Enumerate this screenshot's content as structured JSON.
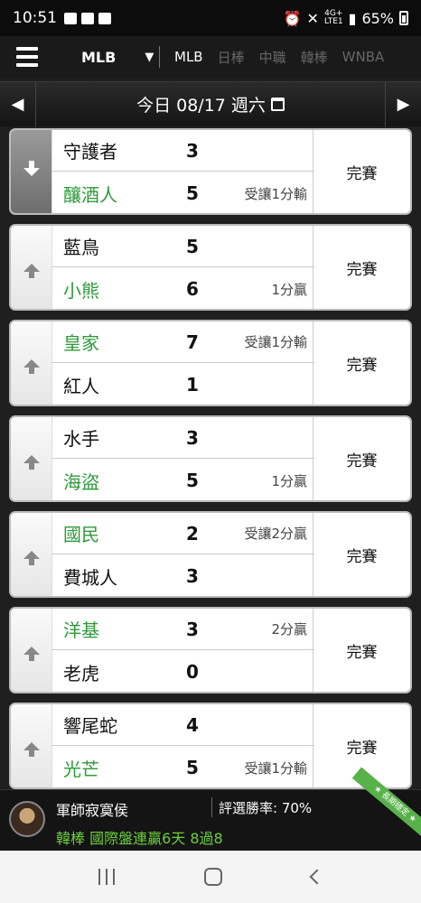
{
  "status_bar": {
    "time": "10:51",
    "network": "4G+",
    "network_sub": "LTE1",
    "battery": "65%"
  },
  "nav": {
    "selected_league": "MLB",
    "tabs": [
      {
        "label": "MLB",
        "active": true
      },
      {
        "label": "日棒",
        "active": false
      },
      {
        "label": "中職",
        "active": false
      },
      {
        "label": "韓棒",
        "active": false
      },
      {
        "label": "WNBA",
        "active": false
      }
    ]
  },
  "date_label": "今日 08/17 週六",
  "games": [
    {
      "expanded": true,
      "home": {
        "team": "守護者",
        "score": "3",
        "note": "",
        "green": false
      },
      "away": {
        "team": "釀酒人",
        "score": "5",
        "note": "受讓1分輸",
        "green": true
      },
      "status": "完賽"
    },
    {
      "expanded": false,
      "home": {
        "team": "藍鳥",
        "score": "5",
        "note": "",
        "green": false
      },
      "away": {
        "team": "小熊",
        "score": "6",
        "note": "1分贏",
        "green": true
      },
      "status": "完賽"
    },
    {
      "expanded": false,
      "home": {
        "team": "皇家",
        "score": "7",
        "note": "受讓1分輸",
        "green": true
      },
      "away": {
        "team": "紅人",
        "score": "1",
        "note": "",
        "green": false
      },
      "status": "完賽"
    },
    {
      "expanded": false,
      "home": {
        "team": "水手",
        "score": "3",
        "note": "",
        "green": false
      },
      "away": {
        "team": "海盜",
        "score": "5",
        "note": "1分贏",
        "green": true
      },
      "status": "完賽"
    },
    {
      "expanded": false,
      "home": {
        "team": "國民",
        "score": "2",
        "note": "受讓2分贏",
        "green": true
      },
      "away": {
        "team": "費城人",
        "score": "3",
        "note": "",
        "green": false
      },
      "status": "完賽"
    },
    {
      "expanded": false,
      "home": {
        "team": "洋基",
        "score": "3",
        "note": "2分贏",
        "green": true
      },
      "away": {
        "team": "老虎",
        "score": "0",
        "note": "",
        "green": false
      },
      "status": "完賽"
    },
    {
      "expanded": false,
      "home": {
        "team": "響尾蛇",
        "score": "4",
        "note": "",
        "green": false
      },
      "away": {
        "team": "光芒",
        "score": "5",
        "note": "受讓1分輸",
        "green": true
      },
      "status": "完賽"
    }
  ],
  "promo": {
    "name": "軍師寂寞侯",
    "rate": "評選勝率: 70%",
    "streak": "韓棒 國際盤連贏6天 8過8",
    "ribbon": "★ 長期穩定 ★"
  },
  "colors": {
    "accent_green": "#2e9a3a",
    "promo_green": "#6ccf3c"
  }
}
